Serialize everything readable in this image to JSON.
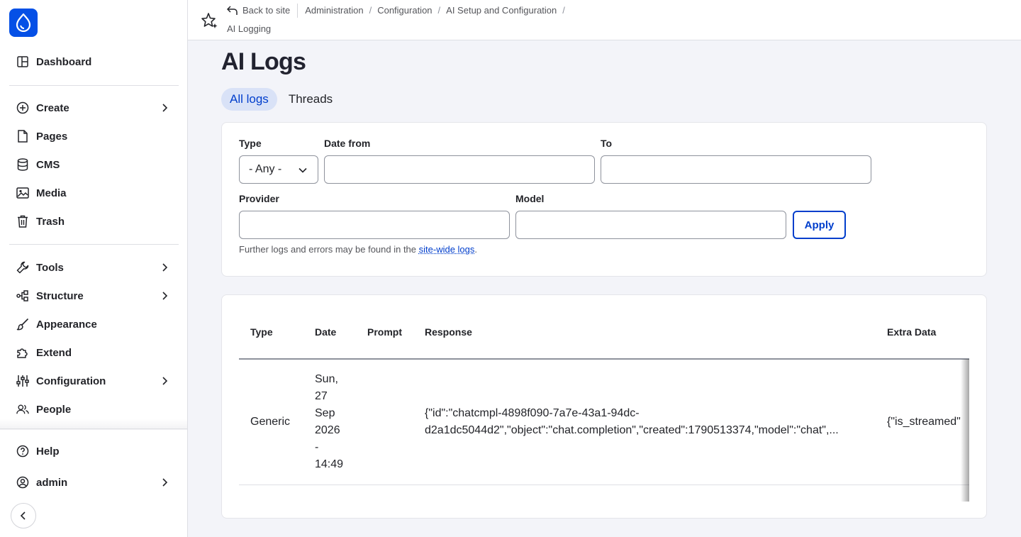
{
  "sidebar": {
    "items": [
      {
        "label": "Dashboard",
        "icon": "dashboard-icon"
      },
      {
        "label": "Create",
        "icon": "plus-circle-icon",
        "has_submenu": true
      },
      {
        "label": "Pages",
        "icon": "page-icon"
      },
      {
        "label": "CMS",
        "icon": "database-icon"
      },
      {
        "label": "Media",
        "icon": "media-icon"
      },
      {
        "label": "Trash",
        "icon": "trash-icon"
      },
      {
        "label": "Tools",
        "icon": "wrench-icon",
        "has_submenu": true
      },
      {
        "label": "Structure",
        "icon": "structure-icon",
        "has_submenu": true
      },
      {
        "label": "Appearance",
        "icon": "brush-icon"
      },
      {
        "label": "Extend",
        "icon": "puzzle-icon"
      },
      {
        "label": "Configuration",
        "icon": "sliders-icon",
        "has_submenu": true
      },
      {
        "label": "People",
        "icon": "people-icon"
      }
    ],
    "bottom": [
      {
        "label": "Help",
        "icon": "help-icon"
      },
      {
        "label": "admin",
        "icon": "user-icon",
        "has_submenu": true
      }
    ]
  },
  "breadcrumb": {
    "back": "Back to site",
    "items": [
      "Administration",
      "Configuration",
      "AI Setup and Configuration"
    ],
    "current": "AI Logging"
  },
  "page": {
    "title": "AI Logs",
    "tabs": [
      "All logs",
      "Threads"
    ],
    "active_tab": "All logs"
  },
  "filters": {
    "type_label": "Type",
    "type_value": "- Any -",
    "date_from_label": "Date from",
    "date_from_value": "",
    "to_label": "To",
    "to_value": "",
    "provider_label": "Provider",
    "provider_value": "",
    "model_label": "Model",
    "model_value": "",
    "apply_label": "Apply",
    "help_prefix": "Further logs and errors may be found in the ",
    "help_link": "site-wide logs",
    "help_suffix": "."
  },
  "table": {
    "headers": [
      "Type",
      "Date",
      "Prompt",
      "Response",
      "Extra Data"
    ],
    "rows": [
      {
        "type": "Generic",
        "date_lines": [
          "Sun,",
          "27",
          "Sep",
          "2026",
          "-",
          "14:49"
        ],
        "prompt": "",
        "response_line1": "{\"id\":\"chatcmpl-4898f090-7a7e-43a1-94dc-",
        "response_line2": "d2a1dc5044d2\",\"object\":\"chat.completion\",\"created\":1790513374,\"model\":\"chat\",...",
        "extra": "{\"is_streamed\":f"
      }
    ]
  },
  "colors": {
    "accent": "#003ecc",
    "logo_bg": "#0550e6",
    "active_tab_bg": "#d9e2f7"
  }
}
